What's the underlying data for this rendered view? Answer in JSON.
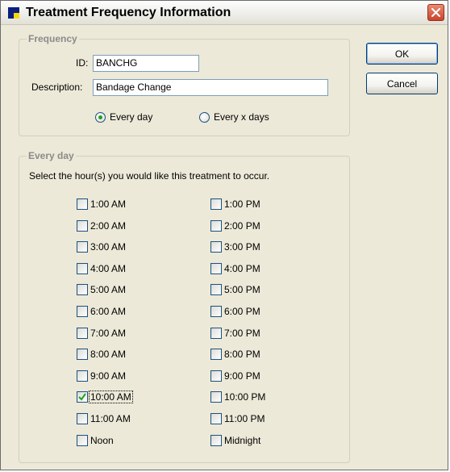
{
  "window": {
    "title": "Treatment Frequency Information"
  },
  "frequency": {
    "legend": "Frequency",
    "id_label": "ID:",
    "id_value": "BANCHG",
    "description_label": "Description:",
    "description_value": "Bandage Change",
    "radio_every_day": "Every day",
    "radio_every_x_days": "Every x days",
    "selected": "every_day"
  },
  "buttons": {
    "ok": "OK",
    "cancel": "Cancel"
  },
  "every_day": {
    "legend": "Every day",
    "instruction": "Select the hour(s) you would like this treatment to occur.",
    "am_hours": [
      {
        "label": "1:00 AM",
        "checked": false
      },
      {
        "label": "2:00 AM",
        "checked": false
      },
      {
        "label": "3:00 AM",
        "checked": false
      },
      {
        "label": "4:00 AM",
        "checked": false
      },
      {
        "label": "5:00 AM",
        "checked": false
      },
      {
        "label": "6:00 AM",
        "checked": false
      },
      {
        "label": "7:00 AM",
        "checked": false
      },
      {
        "label": "8:00 AM",
        "checked": false
      },
      {
        "label": "9:00 AM",
        "checked": false
      },
      {
        "label": "10:00 AM",
        "checked": true
      },
      {
        "label": "11:00 AM",
        "checked": false
      },
      {
        "label": "Noon",
        "checked": false
      }
    ],
    "pm_hours": [
      {
        "label": "1:00 PM",
        "checked": false
      },
      {
        "label": "2:00 PM",
        "checked": false
      },
      {
        "label": "3:00 PM",
        "checked": false
      },
      {
        "label": "4:00 PM",
        "checked": false
      },
      {
        "label": "5:00 PM",
        "checked": false
      },
      {
        "label": "6:00 PM",
        "checked": false
      },
      {
        "label": "7:00 PM",
        "checked": false
      },
      {
        "label": "8:00 PM",
        "checked": false
      },
      {
        "label": "9:00 PM",
        "checked": false
      },
      {
        "label": "10:00 PM",
        "checked": false
      },
      {
        "label": "11:00 PM",
        "checked": false
      },
      {
        "label": "Midnight",
        "checked": false
      }
    ]
  }
}
